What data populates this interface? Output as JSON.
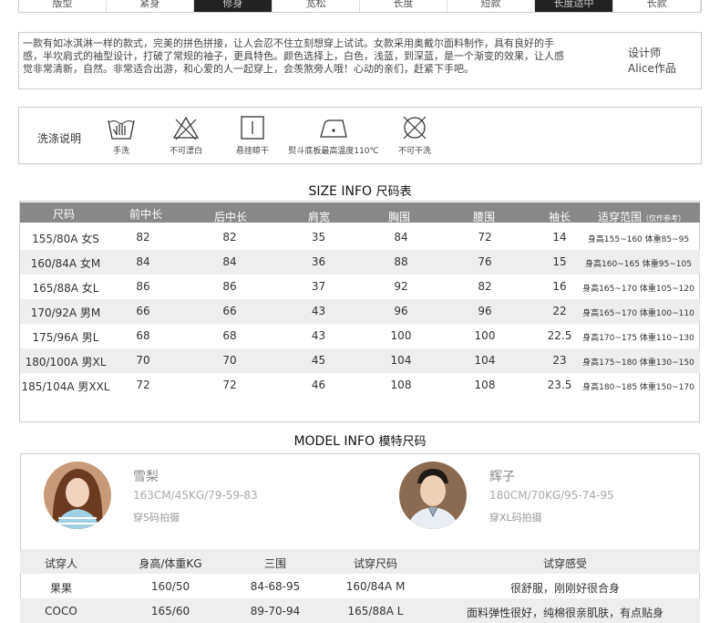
{
  "top_tabs": [
    "版型",
    "紧身",
    "修身",
    "宽松",
    "长度",
    "短款",
    "长度适中",
    "长款"
  ],
  "description": {
    "text": "一款有如冰淇淋一样的款式，完美的拼色拼接，让人会忍不住立刻想穿上试试。女款采用奥戴尔面料制作，具有良好的手感，半坎肩式的袖型设计，打破了常规的袖子，更具特色。颜色选择上，白色，浅蓝，到深蓝，是一个渐变的效果，让人感觉非常清新，自然。非常适合出游，和心爱的人一起穿上，会羡煞旁人哦！心动的亲们，赶紧下手吧。",
    "designer_label": "设计师",
    "designer_name": "Alice作品"
  },
  "wash": {
    "title": "洗涤说明",
    "items": [
      {
        "label": "手洗",
        "icon": "hand-wash-icon"
      },
      {
        "label": "不可漂白",
        "icon": "no-bleach-icon"
      },
      {
        "label": "悬挂晾干",
        "icon": "hang-dry-icon"
      },
      {
        "label": "熨斗底板最高温度110℃",
        "icon": "iron-icon"
      },
      {
        "label": "不可干洗",
        "icon": "no-dry-clean-icon"
      }
    ]
  },
  "size_info": {
    "title_en": "SIZE INFO",
    "title_cn": "尺码表",
    "headers": [
      "尺码",
      "前中长",
      "后中长",
      "肩宽",
      "胸围",
      "腰围",
      "袖长",
      "适穿范围"
    ],
    "header_note": "（仅作参考）",
    "rows": [
      [
        "155/80A 女S",
        "82",
        "82",
        "35",
        "84",
        "72",
        "14",
        "身高155~160 体重85~95"
      ],
      [
        "160/84A 女M",
        "84",
        "84",
        "36",
        "88",
        "76",
        "15",
        "身高160~165 体重95~105"
      ],
      [
        "165/88A 女L",
        "86",
        "86",
        "37",
        "92",
        "82",
        "16",
        "身高165~170 体重105~120"
      ],
      [
        "170/92A 男M",
        "66",
        "66",
        "43",
        "96",
        "96",
        "22",
        "身高165~170 体重100~110"
      ],
      [
        "175/96A 男L",
        "68",
        "68",
        "43",
        "100",
        "100",
        "22.5",
        "身高170~175 体重110~130"
      ],
      [
        "180/100A 男XL",
        "70",
        "70",
        "45",
        "104",
        "104",
        "23",
        "身高175~180 体重130~150"
      ],
      [
        "185/104A 男XXL",
        "72",
        "72",
        "46",
        "108",
        "108",
        "23.5",
        "身高180~185 体重150~170"
      ]
    ]
  },
  "model_info": {
    "title_en": "MODEL INFO",
    "title_cn": "模特尺码",
    "models": [
      {
        "name": "雪梨",
        "stats": "163CM/45KG/79-59-83",
        "note": "穿S码拍摄"
      },
      {
        "name": "辉子",
        "stats": "180CM/70KG/95-74-95",
        "note": "穿XL码拍摄"
      }
    ],
    "headers": [
      "试穿人",
      "身高/体重KG",
      "三围",
      "试穿尺码",
      "试穿感受"
    ],
    "rows": [
      [
        "果果",
        "160/50",
        "84-68-95",
        "160/84A M",
        "很舒服，刚刚好很合身"
      ],
      [
        "COCO",
        "165/60",
        "89-70-94",
        "165/88A L",
        "面料弹性很好，纯棉很亲肌肤，有点贴身"
      ]
    ]
  }
}
